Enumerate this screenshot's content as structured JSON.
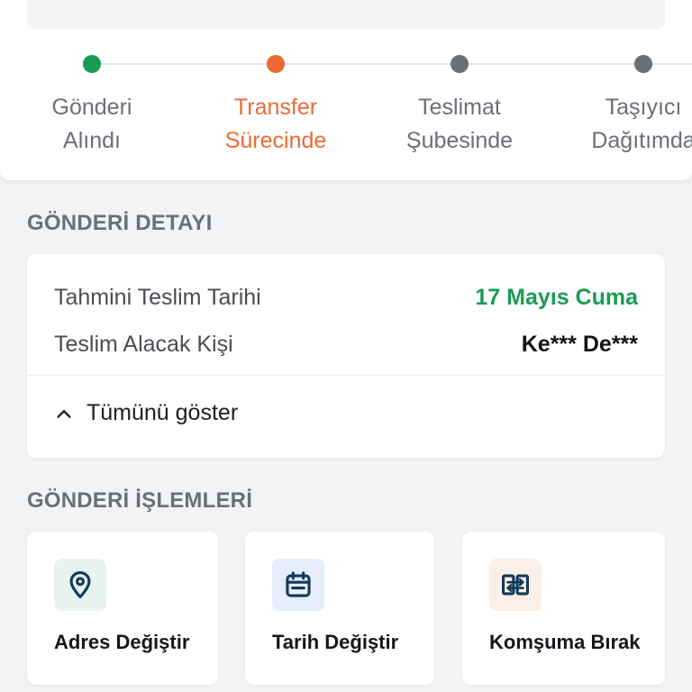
{
  "tracking": {
    "steps": [
      {
        "line1": "Gönderi",
        "line2": "Alındı",
        "status": "completed",
        "dot_color": "#1a9b55"
      },
      {
        "line1": "Transfer",
        "line2": "Sürecinde",
        "status": "active",
        "dot_color": "#ec6a33"
      },
      {
        "line1": "Teslimat",
        "line2": "Şubesinde",
        "status": "pending",
        "dot_color": "#6b6f76"
      },
      {
        "line1": "Taşıyıcı",
        "line2": "Dağıtımda",
        "status": "pending",
        "dot_color": "#6b6f76"
      }
    ]
  },
  "details": {
    "section_title": "GÖNDERİ DETAYI",
    "estimated_date_label": "Tahmini Teslim Tarihi",
    "estimated_date_value": "17 Mayıs Cuma",
    "recipient_label": "Teslim Alacak Kişi",
    "recipient_value": "Ke*** De***",
    "show_all_label": "Tümünü göster"
  },
  "actions": {
    "section_title": "GÖNDERİ İŞLEMLERİ",
    "items": [
      {
        "label": "Adres Değiştir",
        "icon": "location-pin-icon",
        "icon_bg": "#e7f4ed"
      },
      {
        "label": "Tarih Değiştir",
        "icon": "calendar-icon",
        "icon_bg": "#e6eefb"
      },
      {
        "label": "Komşuma Bırak",
        "icon": "neighbor-transfer-icon",
        "icon_bg": "#fcefe7"
      }
    ]
  },
  "colors": {
    "accent_orange": "#ec6a33",
    "success_green": "#1a9b55",
    "icon_navy": "#123a5a"
  }
}
